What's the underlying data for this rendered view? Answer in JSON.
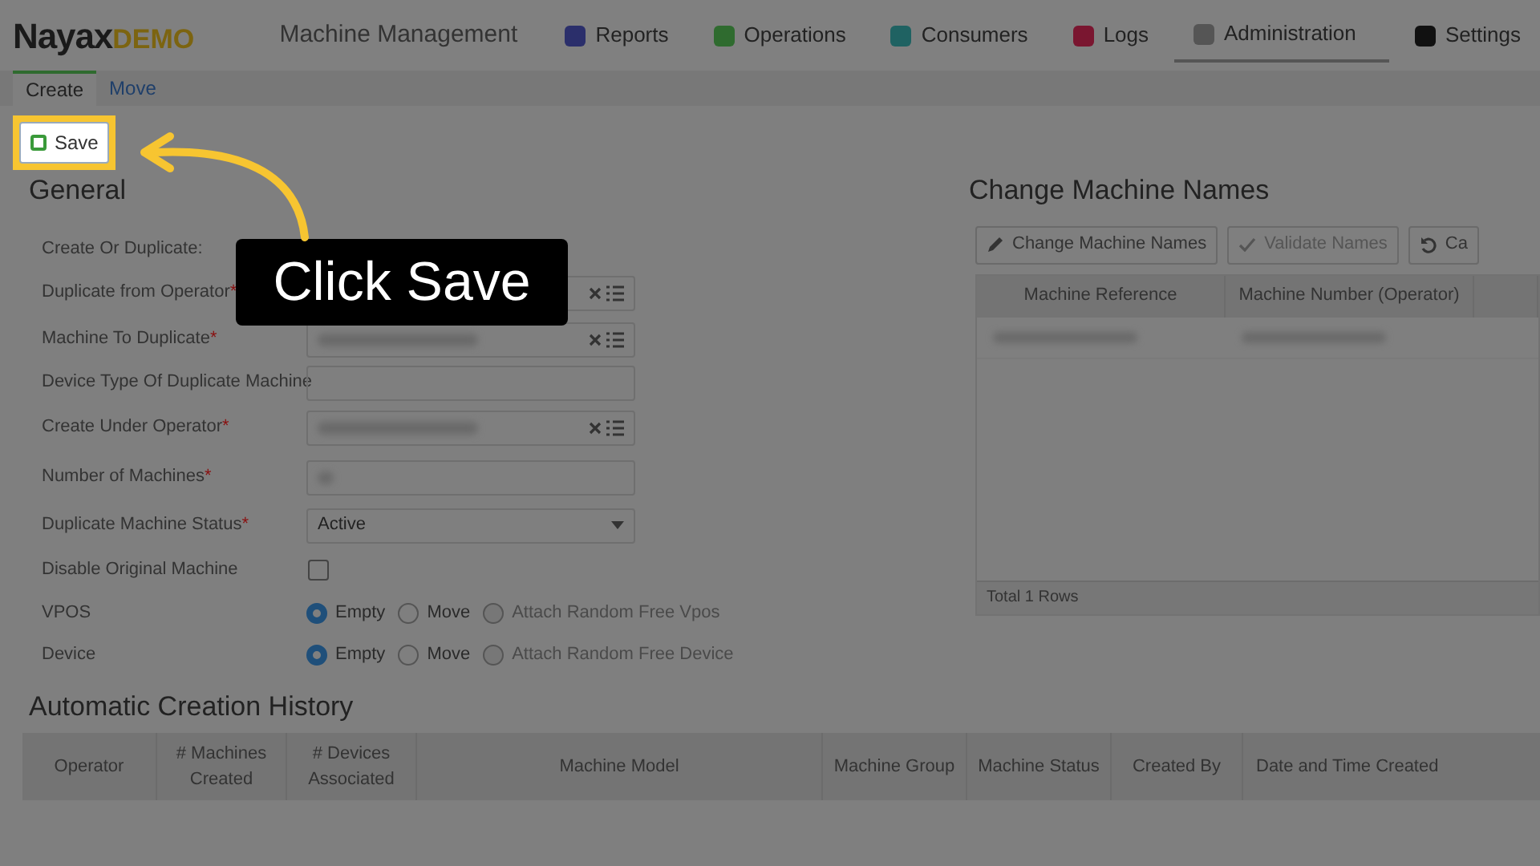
{
  "header": {
    "logo": "Nayax",
    "logo_badge": "DEMO",
    "title": "Machine Management"
  },
  "nav": [
    {
      "label": "Reports",
      "selected": false,
      "color": "#2b2f6b"
    },
    {
      "label": "Operations",
      "selected": false,
      "color": "#2f6b2f"
    },
    {
      "label": "Consumers",
      "selected": false,
      "color": "#1f6262"
    },
    {
      "label": "Logs",
      "selected": false,
      "color": "#7a1630"
    },
    {
      "label": "Administration",
      "selected": true,
      "color": "#555555"
    },
    {
      "label": "Settings",
      "selected": false,
      "color": "#111111"
    }
  ],
  "subtabs": [
    {
      "label": "Create",
      "selected": true
    },
    {
      "label": "Move",
      "selected": false
    }
  ],
  "save_button": {
    "label": "Save",
    "highlighted": true
  },
  "callout": "Click Save",
  "required_mark": "*",
  "general": {
    "title": "General",
    "fields": [
      {
        "label": "Create Or Duplicate:",
        "required": false,
        "kind": "none"
      },
      {
        "label": "Duplicate from Operator",
        "required": true,
        "kind": "lookup"
      },
      {
        "label": "Machine To Duplicate",
        "required": true,
        "kind": "lookup"
      },
      {
        "label": "Device Type Of Duplicate Machine",
        "required": false,
        "kind": "text"
      },
      {
        "label": "Create Under Operator",
        "required": true,
        "kind": "lookup"
      },
      {
        "label": "Number of Machines",
        "required": true,
        "kind": "masked"
      },
      {
        "label": "Duplicate Machine Status",
        "required": true,
        "kind": "select",
        "value": "Active"
      },
      {
        "label": "Disable Original Machine",
        "required": false,
        "kind": "checkbox",
        "checked": false
      },
      {
        "label": "VPOS",
        "required": false,
        "kind": "radio",
        "options": [
          {
            "label": "Empty",
            "selected": true,
            "disabled": false
          },
          {
            "label": "Move",
            "selected": false,
            "disabled": false
          },
          {
            "label": "Attach Random Free Vpos",
            "selected": false,
            "disabled": true
          }
        ]
      },
      {
        "label": "Device",
        "required": false,
        "kind": "radio",
        "options": [
          {
            "label": "Empty",
            "selected": true,
            "disabled": false
          },
          {
            "label": "Move",
            "selected": false,
            "disabled": false
          },
          {
            "label": "Attach Random Free Device",
            "selected": false,
            "disabled": true
          }
        ]
      }
    ]
  },
  "names": {
    "title": "Change Machine Names",
    "buttons": [
      {
        "label": "Change Machine Names",
        "kind": "edit",
        "disabled": false
      },
      {
        "label": "Validate Names",
        "kind": "validate",
        "disabled": true
      },
      {
        "label": "Ca",
        "kind": "undo",
        "disabled": false
      }
    ],
    "columns": [
      "Machine Reference",
      "Machine Number (Operator)"
    ],
    "footer": "Total 1 Rows"
  },
  "history": {
    "title": "Automatic Creation History",
    "columns": [
      "Operator",
      "# Machines Created",
      "# Devices Associated",
      "Machine Model",
      "Machine Group",
      "Machine Status",
      "Created By",
      "Date and Time Created"
    ]
  }
}
